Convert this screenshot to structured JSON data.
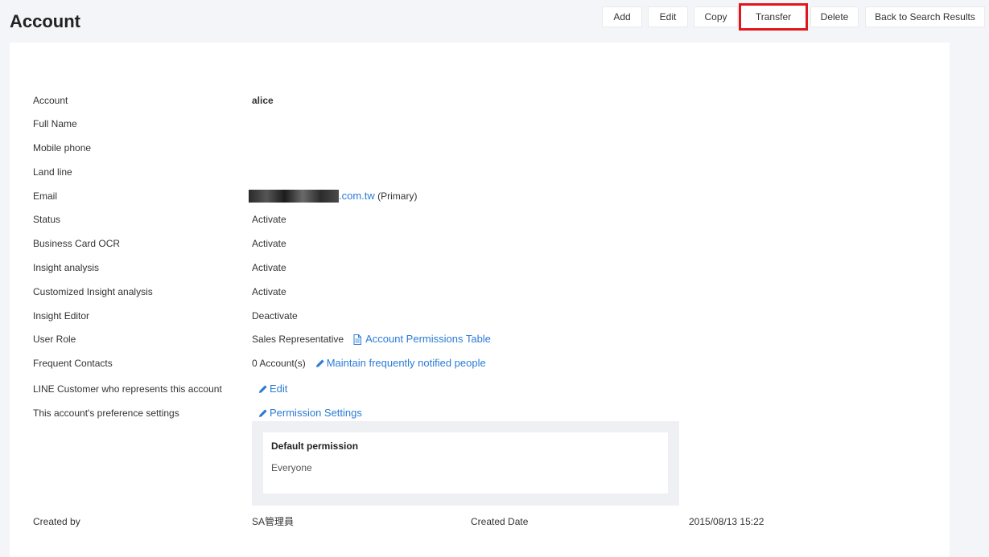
{
  "header": {
    "title": "Account"
  },
  "toolbar": {
    "add": "Add",
    "edit": "Edit",
    "copy": "Copy",
    "transfer": "Transfer",
    "delete": "Delete",
    "back": "Back to Search Results",
    "highlight_color": "#e0161d"
  },
  "fields": {
    "account": {
      "label": "Account",
      "value": "alice"
    },
    "full_name": {
      "label": "Full Name",
      "value": ""
    },
    "mobile": {
      "label": "Mobile phone",
      "value": ""
    },
    "landline": {
      "label": "Land line",
      "value": ""
    },
    "email": {
      "label": "Email",
      "domain": ".com.tw",
      "suffix": "(Primary)"
    },
    "status": {
      "label": "Status",
      "value": "Activate"
    },
    "ocr": {
      "label": "Business Card OCR",
      "value": "Activate"
    },
    "insight": {
      "label": "Insight analysis",
      "value": "Activate"
    },
    "custom_insight": {
      "label": "Customized Insight analysis",
      "value": "Activate"
    },
    "insight_editor": {
      "label": "Insight Editor",
      "value": "Deactivate"
    },
    "user_role": {
      "label": "User Role",
      "value": "Sales Representative",
      "link": "Account Permissions Table"
    },
    "frequent": {
      "label": "Frequent Contacts",
      "value": "0 Account(s)",
      "link": "Maintain frequently notified people"
    },
    "line": {
      "label": "LINE Customer who represents this account",
      "link": "Edit"
    },
    "prefs": {
      "label": "This account's preference settings",
      "link": "Permission Settings"
    },
    "permission": {
      "title": "Default permission",
      "value": "Everyone"
    },
    "created_by": {
      "label": "Created by",
      "value": "SA管理員"
    },
    "created_date": {
      "label": "Created Date",
      "value": "2015/08/13 15:22"
    }
  },
  "colors": {
    "link": "#2a7bd6",
    "background": "#f4f5f9"
  }
}
